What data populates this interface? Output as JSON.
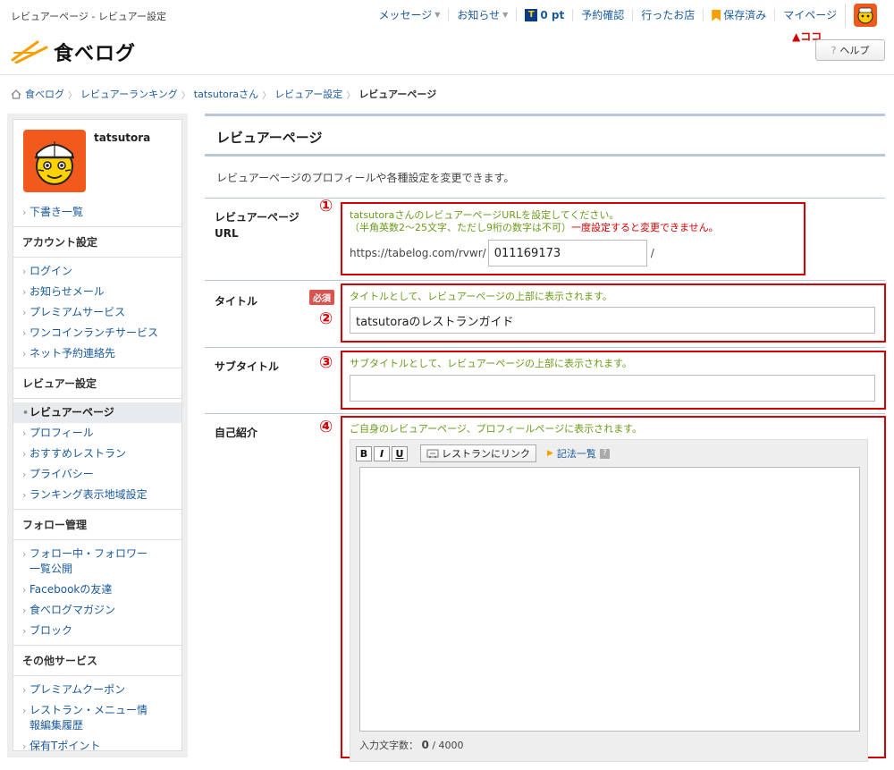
{
  "page_label": "レビュアーページ - レビュアー設定",
  "logo_text": "食べログ",
  "topnav": {
    "messages": "メッセージ",
    "notifications": "お知らせ",
    "points": "0 pt",
    "reservations": "予約確認",
    "visited": "行ったお店",
    "saved": "保存済み",
    "mypage": "マイページ"
  },
  "koko_label": "▲ココ",
  "help_label": "ヘルプ",
  "breadcrumb": [
    "食べログ",
    "レビュアーランキング",
    "tatsutoraさん",
    "レビュアー設定",
    "レビュアーページ"
  ],
  "sidebar": {
    "username": "tatsutora",
    "drafts": "下書き一覧",
    "sections": [
      {
        "heading": "アカウント設定",
        "items": [
          "ログイン",
          "お知らせメール",
          "プレミアムサービス",
          "ワンコインランチサービス",
          "ネット予約連絡先"
        ]
      },
      {
        "heading": "レビュアー設定",
        "items": [
          "レビュアーページ",
          "プロフィール",
          "おすすめレストラン",
          "プライバシー",
          "ランキング表示地域設定"
        ]
      },
      {
        "heading": "フォロー管理",
        "items": [
          "フォロー中・フォロワー一覧公開",
          "Facebookの友達",
          "食べログマガジン",
          "ブロック"
        ]
      },
      {
        "heading": "その他サービス",
        "items": [
          "プレミアムクーポン",
          "レストラン・メニュー情報編集履歴",
          "保有Tポイント"
        ]
      }
    ]
  },
  "main": {
    "title": "レビュアーページ",
    "description": "レビュアーページのプロフィールや各種設定を変更できます。",
    "url_row": {
      "label_line1": "レビュアーページ",
      "label_line2": "URL",
      "num": "①",
      "hint1": "tatsutoraさんのレビュアーページURLを設定してください。",
      "hint2": "（半角英数2～25文字、ただし9桁の数字は不可）",
      "warn": "一度設定すると変更できません。",
      "prefix": "https://tabelog.com/rvwr/",
      "value": "011169173",
      "suffix": "/"
    },
    "title_row": {
      "label": "タイトル",
      "required": "必須",
      "num": "②",
      "hint": "タイトルとして、レビュアーページの上部に表示されます。",
      "value": "tatsutoraのレストランガイド"
    },
    "subtitle_row": {
      "label": "サブタイトル",
      "num": "③",
      "hint": "サブタイトルとして、レビュアーページの上部に表示されます。",
      "value": ""
    },
    "intro_row": {
      "label": "自己紹介",
      "num": "④",
      "hint": "ご自身のレビュアーページ、プロフィールページに表示されます。",
      "bold": "B",
      "italic": "I",
      "underline": "U",
      "restaurant_link": "レストランにリンク",
      "syntax_list": "記法一覧",
      "count_label": "入力文字数：",
      "count_value": "0",
      "count_max": "/ 4000"
    }
  }
}
